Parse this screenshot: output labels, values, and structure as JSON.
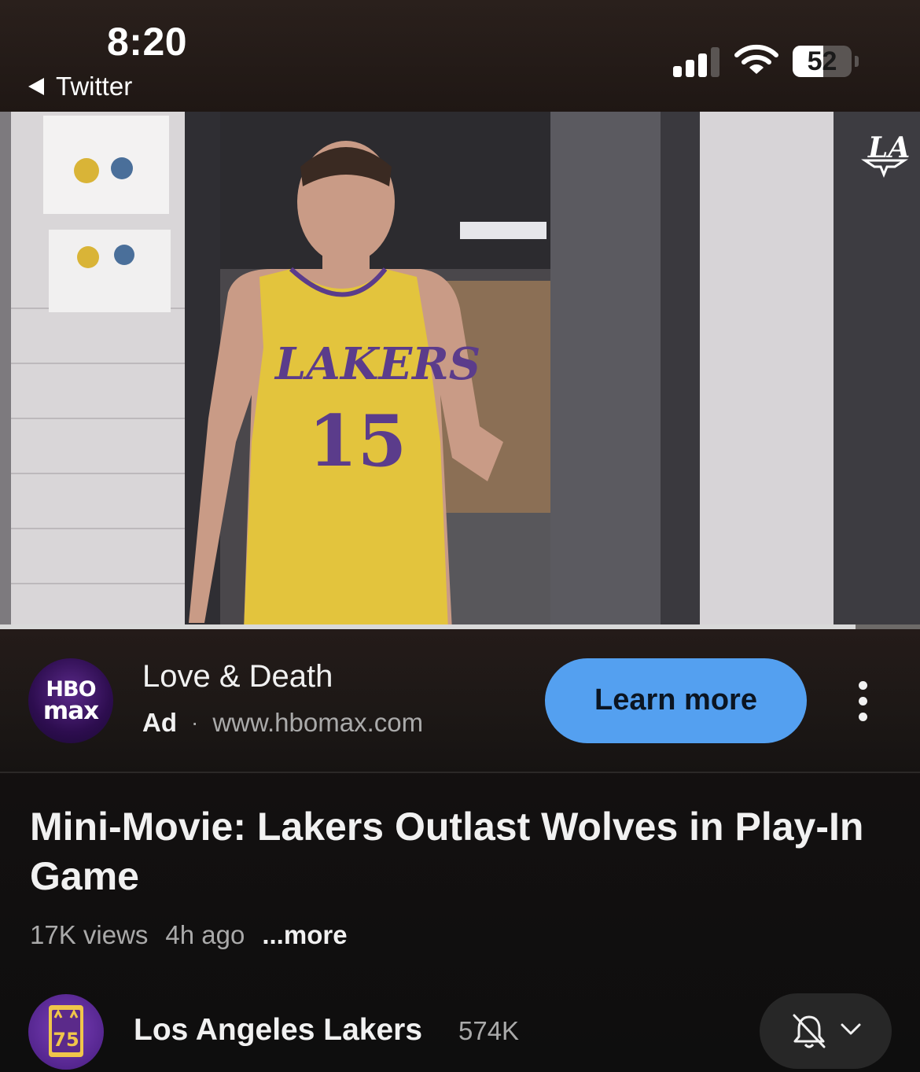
{
  "status_bar": {
    "time": "8:20",
    "back_app": "Twitter",
    "battery": "52",
    "battery_level": 0.52,
    "signal_bars_active": 3,
    "icons": [
      "signal-icon",
      "wifi-icon",
      "battery-icon"
    ]
  },
  "video": {
    "watermark_icon": "lakers-la-logo-icon",
    "progress": 0.93
  },
  "ad": {
    "logo_line1": "HBO",
    "logo_line2": "max",
    "title": "Love & Death",
    "badge": "Ad",
    "separator": "·",
    "url": "www.hbomax.com",
    "cta": "Learn more",
    "menu_icon": "more-vertical-icon",
    "cta_color": "#54a0f0"
  },
  "video_info": {
    "title": "Mini-Movie: Lakers Outlast Wolves in Play-In Game",
    "views": "17K views",
    "age": "4h ago",
    "more": "...more"
  },
  "channel": {
    "name": "Los Angeles Lakers",
    "subscribers": "574K",
    "avatar_text": "75",
    "notification_icon": "bell-off-icon",
    "dropdown_icon": "chevron-down-icon"
  }
}
